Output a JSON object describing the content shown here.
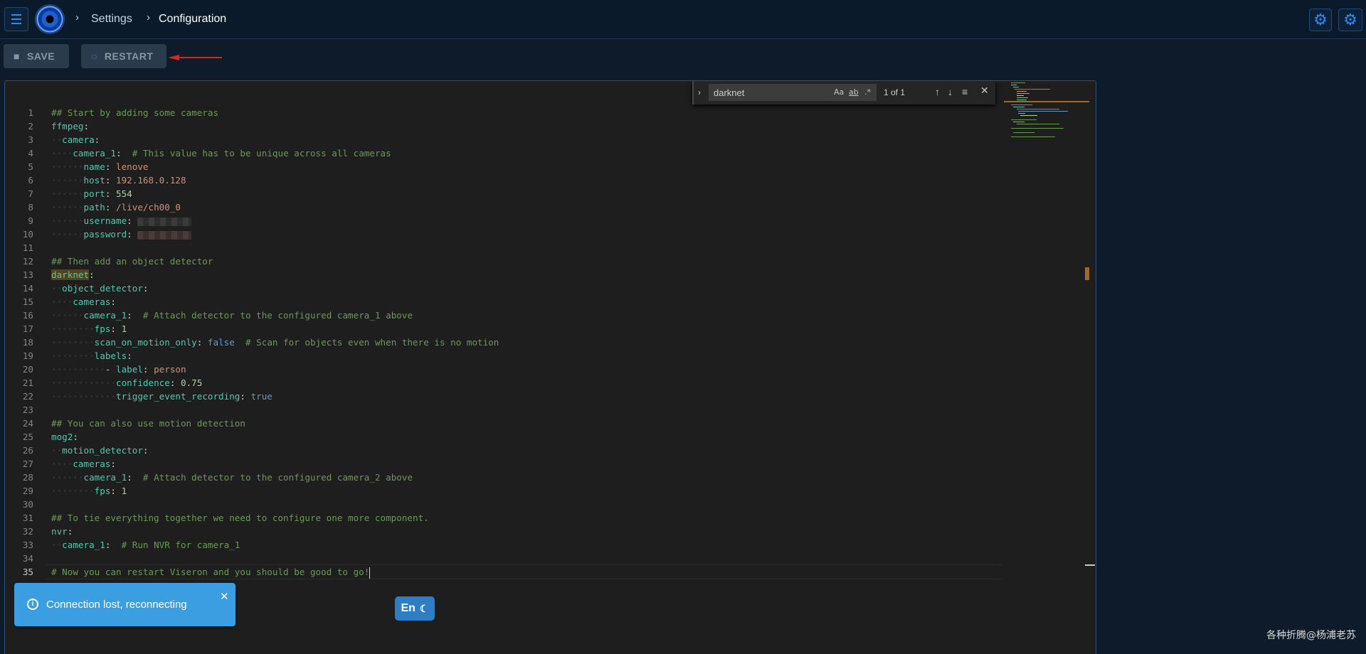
{
  "breadcrumb": {
    "parent": "Settings",
    "current": "Configuration"
  },
  "toolbar": {
    "save_label": "SAVE",
    "restart_label": "RESTART"
  },
  "find": {
    "query": "darknet",
    "count": "1 of 1",
    "match_case": "Aa",
    "whole_word": "ab",
    "regex": ".*"
  },
  "editor": {
    "active_line": 35,
    "lines": [
      {
        "n": "1",
        "segs": [
          [
            "c",
            "## Start by adding some cameras"
          ]
        ]
      },
      {
        "n": "2",
        "segs": [
          [
            "k",
            "ffmpeg"
          ],
          [
            "p",
            ":"
          ]
        ]
      },
      {
        "n": "3",
        "segs": [
          [
            "d",
            "··"
          ],
          [
            "k",
            "camera"
          ],
          [
            "p",
            ":"
          ]
        ]
      },
      {
        "n": "4",
        "segs": [
          [
            "d",
            "····"
          ],
          [
            "k",
            "camera_1"
          ],
          [
            "p",
            ":  "
          ],
          [
            "c",
            "# This value has to be unique across all cameras"
          ]
        ]
      },
      {
        "n": "5",
        "segs": [
          [
            "d",
            "······"
          ],
          [
            "k",
            "name"
          ],
          [
            "p",
            ": "
          ],
          [
            "s",
            "lenove"
          ]
        ]
      },
      {
        "n": "6",
        "segs": [
          [
            "d",
            "······"
          ],
          [
            "k",
            "host"
          ],
          [
            "p",
            ": "
          ],
          [
            "s",
            "192.168.0.128"
          ]
        ]
      },
      {
        "n": "7",
        "segs": [
          [
            "d",
            "······"
          ],
          [
            "k",
            "port"
          ],
          [
            "p",
            ": "
          ],
          [
            "n",
            "554"
          ]
        ]
      },
      {
        "n": "8",
        "segs": [
          [
            "d",
            "······"
          ],
          [
            "k",
            "path"
          ],
          [
            "p",
            ": "
          ],
          [
            "s",
            "/live/ch00_0"
          ]
        ]
      },
      {
        "n": "9",
        "segs": [
          [
            "d",
            "······"
          ],
          [
            "k",
            "username"
          ],
          [
            "p",
            ": "
          ],
          [
            "blur",
            ""
          ]
        ]
      },
      {
        "n": "10",
        "segs": [
          [
            "d",
            "······"
          ],
          [
            "k",
            "password"
          ],
          [
            "p",
            ": "
          ],
          [
            "blurpw",
            ""
          ]
        ]
      },
      {
        "n": "11",
        "segs": []
      },
      {
        "n": "12",
        "segs": [
          [
            "c",
            "## Then add an object detector"
          ]
        ]
      },
      {
        "n": "13",
        "segs": [
          [
            "hl",
            "darknet"
          ],
          [
            "p",
            ":"
          ]
        ]
      },
      {
        "n": "14",
        "segs": [
          [
            "d",
            "··"
          ],
          [
            "k",
            "object_detector"
          ],
          [
            "p",
            ":"
          ]
        ]
      },
      {
        "n": "15",
        "segs": [
          [
            "d",
            "····"
          ],
          [
            "k",
            "cameras"
          ],
          [
            "p",
            ":"
          ]
        ]
      },
      {
        "n": "16",
        "segs": [
          [
            "d",
            "······"
          ],
          [
            "k",
            "camera_1"
          ],
          [
            "p",
            ":  "
          ],
          [
            "c",
            "# Attach detector to the configured camera_1 above"
          ]
        ]
      },
      {
        "n": "17",
        "segs": [
          [
            "d",
            "········"
          ],
          [
            "k",
            "fps"
          ],
          [
            "p",
            ": "
          ],
          [
            "n",
            "1"
          ]
        ]
      },
      {
        "n": "18",
        "segs": [
          [
            "d",
            "········"
          ],
          [
            "k",
            "scan_on_motion_only"
          ],
          [
            "p",
            ": "
          ],
          [
            "b",
            "false"
          ],
          [
            "p",
            "  "
          ],
          [
            "c",
            "# Scan for objects even when there is no motion"
          ]
        ]
      },
      {
        "n": "19",
        "segs": [
          [
            "d",
            "········"
          ],
          [
            "k",
            "labels"
          ],
          [
            "p",
            ":"
          ]
        ]
      },
      {
        "n": "20",
        "segs": [
          [
            "d",
            "··········"
          ],
          [
            "p",
            "- "
          ],
          [
            "k",
            "label"
          ],
          [
            "p",
            ": "
          ],
          [
            "s",
            "person"
          ]
        ]
      },
      {
        "n": "21",
        "segs": [
          [
            "d",
            "············"
          ],
          [
            "k",
            "confidence"
          ],
          [
            "p",
            ": "
          ],
          [
            "n",
            "0.75"
          ]
        ]
      },
      {
        "n": "22",
        "segs": [
          [
            "d",
            "············"
          ],
          [
            "k",
            "trigger_event_recording"
          ],
          [
            "p",
            ": "
          ],
          [
            "b",
            "true"
          ]
        ]
      },
      {
        "n": "23",
        "segs": []
      },
      {
        "n": "24",
        "segs": [
          [
            "c",
            "## You can also use motion detection"
          ]
        ]
      },
      {
        "n": "25",
        "segs": [
          [
            "k",
            "mog2"
          ],
          [
            "p",
            ":"
          ]
        ]
      },
      {
        "n": "26",
        "segs": [
          [
            "d",
            "··"
          ],
          [
            "k",
            "motion_detector"
          ],
          [
            "p",
            ":"
          ]
        ]
      },
      {
        "n": "27",
        "segs": [
          [
            "d",
            "····"
          ],
          [
            "k",
            "cameras"
          ],
          [
            "p",
            ":"
          ]
        ]
      },
      {
        "n": "28",
        "segs": [
          [
            "d",
            "······"
          ],
          [
            "k",
            "camera_1"
          ],
          [
            "p",
            ":  "
          ],
          [
            "c",
            "# Attach detector to the configured camera_2 above"
          ]
        ]
      },
      {
        "n": "29",
        "segs": [
          [
            "d",
            "········"
          ],
          [
            "k",
            "fps"
          ],
          [
            "p",
            ": "
          ],
          [
            "n",
            "1"
          ]
        ]
      },
      {
        "n": "30",
        "segs": []
      },
      {
        "n": "31",
        "segs": [
          [
            "c",
            "## To tie everything together we need to configure one more component."
          ]
        ]
      },
      {
        "n": "32",
        "segs": [
          [
            "k",
            "nvr"
          ],
          [
            "p",
            ":"
          ]
        ]
      },
      {
        "n": "33",
        "segs": [
          [
            "d",
            "··"
          ],
          [
            "k",
            "camera_1"
          ],
          [
            "p",
            ":  "
          ],
          [
            "c",
            "# Run NVR for camera_1"
          ]
        ]
      },
      {
        "n": "34",
        "segs": []
      },
      {
        "n": "35",
        "segs": [
          [
            "c",
            "# Now you can restart Viseron and you should be good to go!"
          ],
          [
            "caret",
            ""
          ]
        ]
      }
    ]
  },
  "toast": {
    "message": "Connection lost, reconnecting"
  },
  "lang_toggle": {
    "label": "En"
  },
  "watermark": "各种折腾@杨浦老苏",
  "colors": {
    "accent": "#2d8cf0",
    "toast_bg": "#3a9ee0",
    "editor_bg": "#1e1e1e",
    "match_highlight": "#5a4117"
  },
  "icons": {
    "menu": "hamburger-icon",
    "settings": "gear-icon",
    "save": "floppy-disk-icon",
    "restart": "spinner-icon",
    "info": "info-icon",
    "close": "close-icon",
    "moon": "moon-icon"
  }
}
